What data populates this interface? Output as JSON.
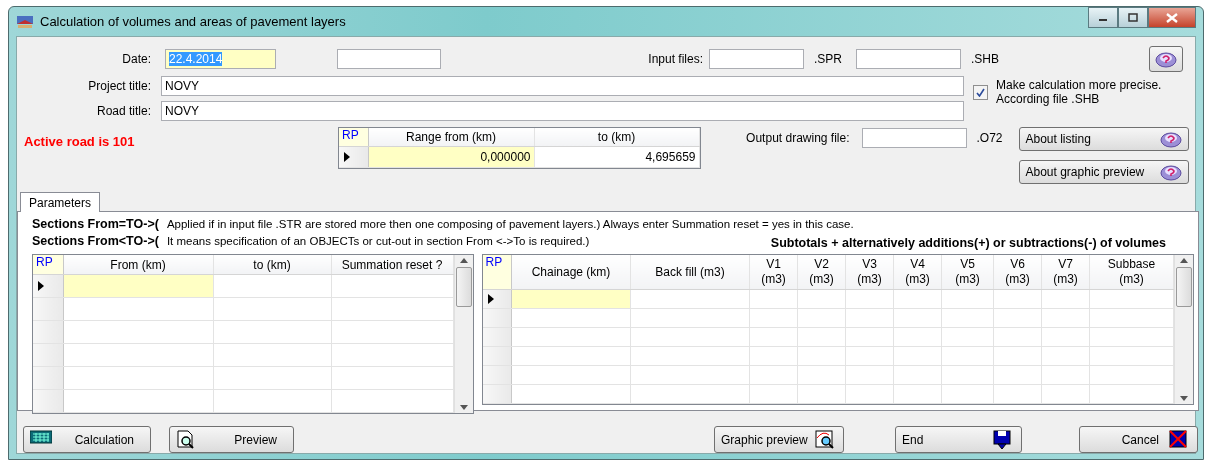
{
  "window": {
    "title": "Calculation of volumes and areas of pavement layers"
  },
  "date": {
    "label": "Date:",
    "value": "22.4.2014",
    "highlighted": true
  },
  "input_files": {
    "label": "Input files:",
    "extensions": [
      ".SPR",
      ".SHB"
    ]
  },
  "project_title": {
    "label": "Project title:",
    "value": "NOVY"
  },
  "road_title": {
    "label": "Road title:",
    "value": "NOVY"
  },
  "precise_checkbox": {
    "lines": [
      "Make calculation more precise.",
      "According file .SHB"
    ],
    "checked": true
  },
  "active_road": "Active road is 101",
  "range_grid": {
    "corner": "RP",
    "columns": [
      "Range from (km)",
      "to (km)"
    ],
    "rows": [
      {
        "current": true,
        "cells": [
          "0,000000",
          "4,695659"
        ]
      }
    ]
  },
  "output_drawing": {
    "label": "Output drawing file:",
    "extension": ".O72"
  },
  "about_buttons": [
    "About listing",
    "About graphic preview"
  ],
  "tabs": [
    {
      "label": "Parameters",
      "selected": true
    }
  ],
  "notes": [
    {
      "heading": "Sections From=TO->(",
      "text": "Applied if in input file .STR are stored more then one composing of pavement layers.) Always enter Summation reset = yes in this case."
    },
    {
      "heading": "Sections From<TO->(",
      "text": "It means specification of an OBJECTs or cut-out in section From <->To is required.)"
    }
  ],
  "subtotals_title": "Subtotals + alternatively additions(+) or subtractions(-) of volumes",
  "sections_grid": {
    "corner": "RP",
    "columns": [
      "From (km)",
      "to (km)",
      "Summation reset ?"
    ],
    "rows": [
      {
        "current": true
      },
      {
        "current": false
      },
      {
        "current": false
      },
      {
        "current": false
      },
      {
        "current": false
      },
      {
        "current": false
      }
    ]
  },
  "volumes_grid": {
    "corner": "RP",
    "columns": [
      "Chainage (km)",
      "Back fill (m3)",
      "V1\n(m3)",
      "V2\n(m3)",
      "V3\n(m3)",
      "V4\n(m3)",
      "V5\n(m3)",
      "V6\n(m3)",
      "V7\n(m3)",
      "Subbase\n(m3)"
    ],
    "rows": [
      {
        "current": true
      },
      {
        "current": false
      },
      {
        "current": false
      },
      {
        "current": false
      },
      {
        "current": false
      },
      {
        "current": false
      }
    ]
  },
  "buttons": [
    {
      "label": "Calculation",
      "kind": "calculator"
    },
    {
      "label": "Preview",
      "kind": "preview"
    },
    {
      "label": "Graphic preview",
      "kind": "graphic"
    },
    {
      "label": "End",
      "kind": "end"
    },
    {
      "label": "Cancel",
      "kind": "cancel"
    }
  ]
}
